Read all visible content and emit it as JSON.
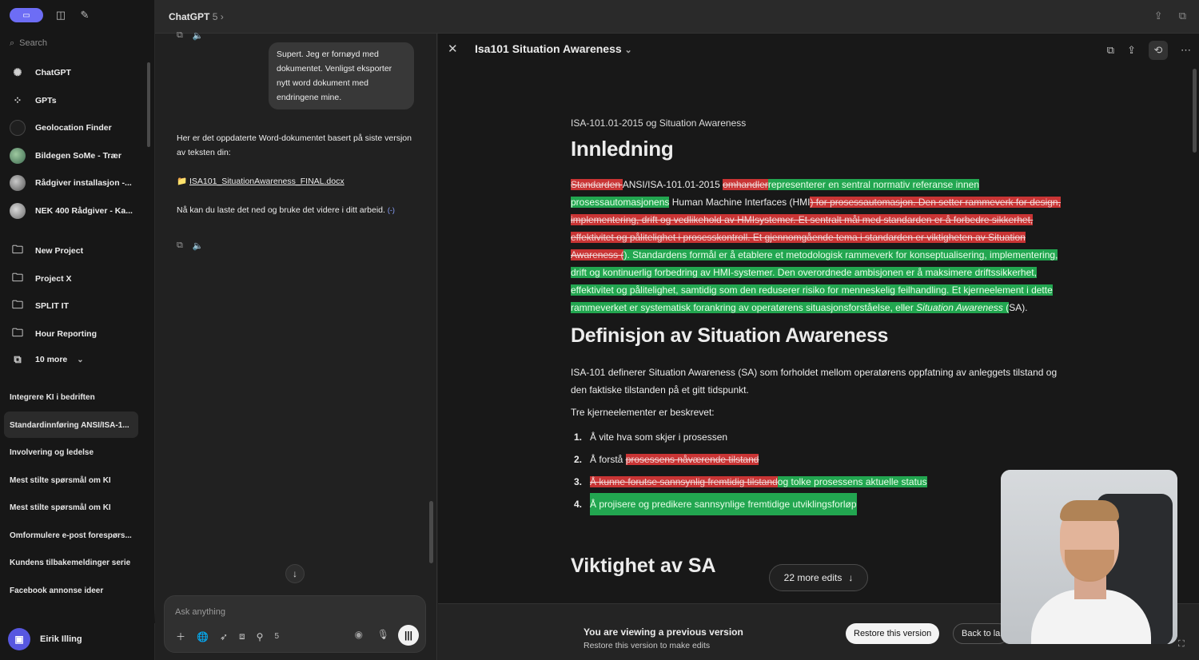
{
  "sidebar": {
    "search_placeholder": "Search",
    "nav": [
      {
        "label": "ChatGPT",
        "icon": "openai-icon"
      },
      {
        "label": "GPTs",
        "icon": "grid-icon"
      },
      {
        "label": "Geolocation Finder",
        "icon": "gpt-avatar-icon"
      },
      {
        "label": "Bildegen SoMe - Trær",
        "icon": "gpt-avatar-icon"
      },
      {
        "label": "Rådgiver installasjon -...",
        "icon": "gpt-avatar-icon"
      },
      {
        "label": "NEK 400 Rådgiver - Ka...",
        "icon": "gpt-avatar-icon"
      }
    ],
    "projects": [
      {
        "label": "New Project",
        "icon": "new-folder-icon"
      },
      {
        "label": "Project X",
        "icon": "folder-icon"
      },
      {
        "label": "SPLIT IT",
        "icon": "folder-icon"
      },
      {
        "label": "Hour Reporting",
        "icon": "folder-icon"
      }
    ],
    "more_label": "10 more",
    "chats": [
      "Integrere KI i bedriften",
      "Standardinnføring ANSI/ISA-1...",
      "Involvering og ledelse",
      "Mest stilte spørsmål om KI",
      "Mest stilte spørsmål om KI",
      "Omformulere e-post forespørs...",
      "Kundens tilbakemeldinger serie",
      "Facebook annonse ideer"
    ],
    "user_name": "Eirik Illing"
  },
  "topbar": {
    "model": "ChatGPT",
    "model_version": "5"
  },
  "chat": {
    "user_message": "Supert. Jeg er fornøyd med dokumentet. Venligst eksporter nytt word dokument med endringene mine.",
    "assistant_intro": "Her er det oppdaterte Word-dokumentet basert på siste versjon av teksten din:",
    "file_name": "ISA101_SituationAwareness_FINAL.docx",
    "assistant_outro": "Nå kan du laste det ned og bruke det videre i ditt arbeid.",
    "cite": "(-)",
    "composer_placeholder": "Ask anything",
    "composer_count": "5"
  },
  "canvas": {
    "title": "Isa101 Situation Awareness",
    "subtitle": "ISA-101.01-2015 og Situation Awareness",
    "h1": "Innledning",
    "p1": {
      "del1": "Standarden ",
      "t1": "ANSI/ISA-101.01-2015 ",
      "del2": "omhandler",
      "ins1": "representerer en sentral normativ referanse innen prosessautomasjonens",
      "t2": " Human Machine Interfaces (HMI",
      "del3": ") for prosessautomasjon. Den setter rammeverk for design, implementering, drift og vedlikehold av HMIsystemer. Et sentralt mål med standarden er å forbedre sikkerhet, effektivitet og pålitelighet i prosesskontroll. Et gjennomgående tema i standarden er viktigheten av Situation Awareness (",
      "ins2": "). Standardens formål er å etablere et metodologisk rammeverk for konseptualisering, implementering, drift og kontinuerlig forbedring av HMI-systemer. Den overordnede ambisjonen er å maksimere driftssikkerhet, effektivitet og pålitelighet, samtidig som den reduserer risiko for menneskelig feilhandling. Et kjerneelement i dette rammeverket er systematisk forankring av operatørens situasjonsforståelse, eller ",
      "ins2_em": "Situation Awareness",
      "ins3": " (",
      "t3": "SA)."
    },
    "h2": "Definisjon av Situation Awareness",
    "p2": "ISA-101 definerer Situation Awareness (SA) som forholdet mellom operatørens oppfatning av anleggets tilstand og den faktiske tilstanden på et gitt tidspunkt.",
    "p3": "Tre kjerneelementer er beskrevet:",
    "list": [
      {
        "n": "1.",
        "text": "Å vite hva som skjer i prosessen"
      },
      {
        "n": "2.",
        "text": "Å forstå ",
        "del": "prosessens nåværende tilstand"
      },
      {
        "n": "3.",
        "del": "Å kunne forutse sannsynlig fremtidig tilstand",
        "ins": "og tolke prosessens aktuelle status"
      },
      {
        "n": "4.",
        "ins": "Å projisere og predikere sannsynlige fremtidige utviklingsforløp"
      }
    ],
    "h3": "Viktighet av SA",
    "edits_label": "22 more edits",
    "version_title": "You are viewing a previous version",
    "version_sub": "Restore this version to make edits",
    "restore_label": "Restore this version",
    "back_label": "Back to la"
  }
}
